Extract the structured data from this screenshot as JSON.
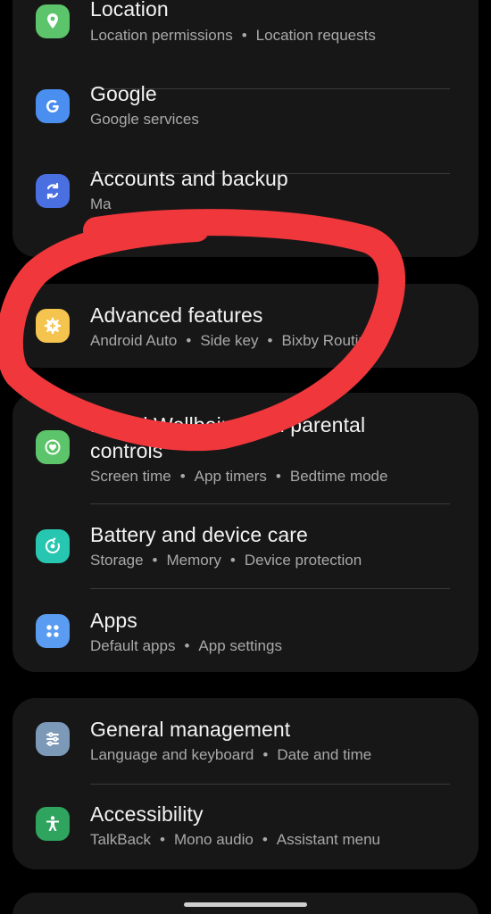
{
  "settings": {
    "location": {
      "title": "Location",
      "subtitle": [
        "Location permissions",
        "Location requests"
      ],
      "icon": "location-pin-icon",
      "color": "#5cc46a"
    },
    "google": {
      "title": "Google",
      "subtitle": [
        "Google services"
      ],
      "icon": "google-g-icon",
      "color": "#4a8ff0"
    },
    "accounts": {
      "title": "Accounts and backup",
      "subtitle": [
        "Ma"
      ],
      "icon": "sync-icon",
      "color": "#4a6fe0"
    },
    "advanced": {
      "title": "Advanced features",
      "subtitle": [
        "Android Auto",
        "Side key",
        "Bixby Routines"
      ],
      "icon": "gear-plus-icon",
      "color": "#f5c44e"
    },
    "wellbeing": {
      "title": "Digital Wellbeing and parental controls",
      "title_line1": "Digital Wellbeing and parental",
      "title_line2": "controls",
      "subtitle": [
        "Screen time",
        "App timers",
        "Bedtime mode"
      ],
      "icon": "heart-circle-icon",
      "color": "#5cc46a"
    },
    "battery": {
      "title": "Battery and device care",
      "subtitle": [
        "Storage",
        "Memory",
        "Device protection"
      ],
      "icon": "device-care-icon",
      "color": "#27c6b0"
    },
    "apps": {
      "title": "Apps",
      "subtitle": [
        "Default apps",
        "App settings"
      ],
      "icon": "apps-grid-icon",
      "color": "#5a9cf2"
    },
    "general": {
      "title": "General management",
      "subtitle": [
        "Language and keyboard",
        "Date and time"
      ],
      "icon": "sliders-icon",
      "color": "#7c99b8"
    },
    "accessibility": {
      "title": "Accessibility",
      "subtitle": [
        "TalkBack",
        "Mono audio",
        "Assistant menu"
      ],
      "icon": "accessibility-person-icon",
      "color": "#2fa45e"
    }
  },
  "annotation": {
    "type": "hand-drawn circle",
    "color": "#f0373c"
  }
}
